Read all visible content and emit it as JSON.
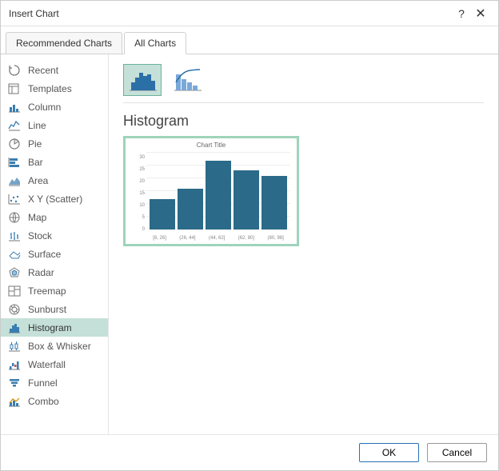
{
  "dialog": {
    "title": "Insert Chart",
    "help": "?",
    "close": "✕"
  },
  "tabs": [
    {
      "label": "Recommended Charts",
      "active": false
    },
    {
      "label": "All Charts",
      "active": true
    }
  ],
  "sidebar": {
    "items": [
      {
        "label": "Recent",
        "icon": "recent-icon"
      },
      {
        "label": "Templates",
        "icon": "templates-icon"
      },
      {
        "label": "Column",
        "icon": "column-icon"
      },
      {
        "label": "Line",
        "icon": "line-icon"
      },
      {
        "label": "Pie",
        "icon": "pie-icon"
      },
      {
        "label": "Bar",
        "icon": "bar-icon"
      },
      {
        "label": "Area",
        "icon": "area-icon"
      },
      {
        "label": "X Y (Scatter)",
        "icon": "scatter-icon"
      },
      {
        "label": "Map",
        "icon": "map-icon"
      },
      {
        "label": "Stock",
        "icon": "stock-icon"
      },
      {
        "label": "Surface",
        "icon": "surface-icon"
      },
      {
        "label": "Radar",
        "icon": "radar-icon"
      },
      {
        "label": "Treemap",
        "icon": "treemap-icon"
      },
      {
        "label": "Sunburst",
        "icon": "sunburst-icon"
      },
      {
        "label": "Histogram",
        "icon": "histogram-icon",
        "selected": true
      },
      {
        "label": "Box & Whisker",
        "icon": "box-icon"
      },
      {
        "label": "Waterfall",
        "icon": "waterfall-icon"
      },
      {
        "label": "Funnel",
        "icon": "funnel-icon"
      },
      {
        "label": "Combo",
        "icon": "combo-icon"
      }
    ]
  },
  "main": {
    "heading": "Histogram",
    "subtypes": [
      {
        "name": "histogram-subtype",
        "selected": true
      },
      {
        "name": "pareto-subtype",
        "selected": false
      }
    ]
  },
  "chart_data": {
    "type": "bar",
    "title": "Chart Title",
    "categories": [
      "[8, 26]",
      "(26, 44]",
      "(44, 62]",
      "(62, 80]",
      "(80, 98]"
    ],
    "values": [
      12,
      16,
      27,
      23,
      21
    ],
    "ylim": [
      0,
      30
    ],
    "yticks": [
      0,
      5,
      10,
      15,
      20,
      25,
      30
    ],
    "xlabel": "",
    "ylabel": ""
  },
  "footer": {
    "ok": "OK",
    "cancel": "Cancel"
  }
}
